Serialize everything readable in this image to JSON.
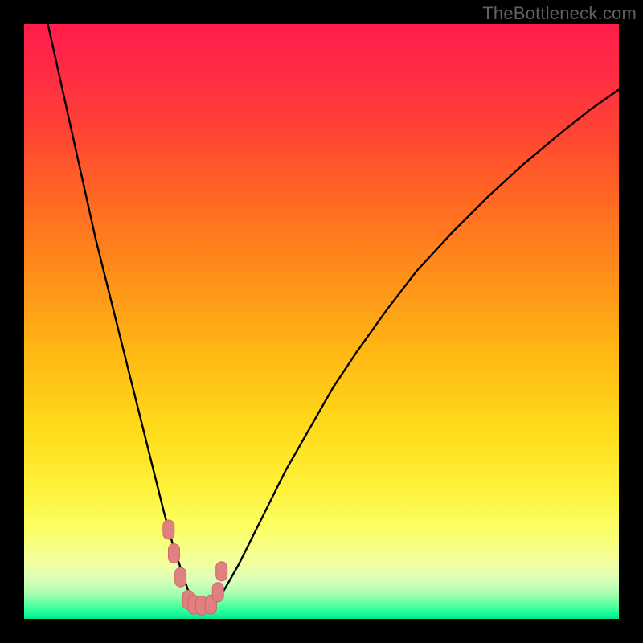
{
  "attribution": "TheBottleneck.com",
  "colors": {
    "frame": "#000000",
    "attribution_text": "#616161",
    "curve_stroke": "#000000",
    "marker_fill": "#e08080",
    "marker_stroke": "#d06868",
    "gradient_stops": [
      {
        "offset": 0.0,
        "color": "#ff1d4c"
      },
      {
        "offset": 0.08,
        "color": "#ff2a44"
      },
      {
        "offset": 0.18,
        "color": "#ff4433"
      },
      {
        "offset": 0.3,
        "color": "#ff6a22"
      },
      {
        "offset": 0.42,
        "color": "#ff8e1a"
      },
      {
        "offset": 0.55,
        "color": "#ffb714"
      },
      {
        "offset": 0.68,
        "color": "#ffdb1a"
      },
      {
        "offset": 0.78,
        "color": "#fff23a"
      },
      {
        "offset": 0.85,
        "color": "#fbff66"
      },
      {
        "offset": 0.905,
        "color": "#f4ffa0"
      },
      {
        "offset": 0.935,
        "color": "#d9ffb8"
      },
      {
        "offset": 0.958,
        "color": "#a8ffb0"
      },
      {
        "offset": 0.975,
        "color": "#5effa0"
      },
      {
        "offset": 0.99,
        "color": "#1bff9e"
      },
      {
        "offset": 1.0,
        "color": "#05e58f"
      }
    ]
  },
  "chart_data": {
    "type": "line",
    "title": "",
    "xlabel": "",
    "ylabel": "",
    "xlim": [
      0,
      100
    ],
    "ylim": [
      0,
      100
    ],
    "series": [
      {
        "name": "bottleneck-curve",
        "x": [
          4,
          6,
          8,
          10,
          12,
          14,
          16,
          18,
          20,
          22,
          23.5,
          25,
          26.5,
          27.5,
          28.5,
          29.5,
          31,
          32.5,
          34,
          36,
          38,
          41,
          44,
          48,
          52,
          56,
          61,
          66,
          72,
          78,
          84,
          90,
          95,
          100
        ],
        "y": [
          100,
          91,
          82,
          73,
          64,
          56,
          48,
          40,
          32,
          24,
          18,
          12.5,
          8,
          5,
          3,
          2,
          2,
          3,
          5.5,
          9,
          13,
          19,
          25,
          32,
          39,
          45,
          52,
          58.5,
          65,
          71,
          76.5,
          81.5,
          85.5,
          89
        ]
      }
    ],
    "markers": [
      {
        "x": 24.3,
        "y": 15.0
      },
      {
        "x": 25.2,
        "y": 11.0
      },
      {
        "x": 26.3,
        "y": 7.0
      },
      {
        "x": 27.6,
        "y": 3.2
      },
      {
        "x": 28.5,
        "y": 2.4
      },
      {
        "x": 29.8,
        "y": 2.2
      },
      {
        "x": 31.4,
        "y": 2.4
      },
      {
        "x": 32.6,
        "y": 4.5
      },
      {
        "x": 33.2,
        "y": 8.0
      }
    ]
  }
}
